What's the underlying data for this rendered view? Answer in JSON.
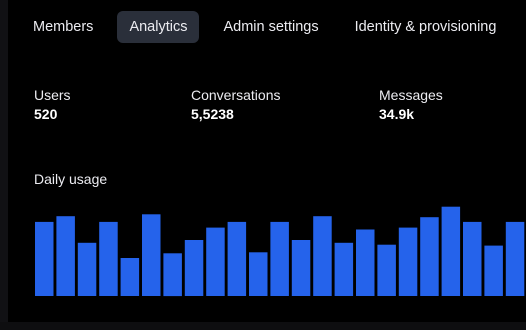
{
  "tabs": [
    {
      "label": "Members",
      "active": false
    },
    {
      "label": "Analytics",
      "active": true
    },
    {
      "label": "Admin settings",
      "active": false
    },
    {
      "label": "Identity & provisioning",
      "active": false
    }
  ],
  "stats": [
    {
      "label": "Users",
      "value": "520"
    },
    {
      "label": "Conversations",
      "value": "5,5238"
    },
    {
      "label": "Messages",
      "value": "34.9k"
    }
  ],
  "daily_usage": {
    "title": "Daily usage"
  },
  "chart_data": {
    "type": "bar",
    "title": "Daily usage",
    "xlabel": "",
    "ylabel": "",
    "values": [
      78,
      84,
      56,
      78,
      40,
      86,
      45,
      59,
      72,
      78,
      46,
      78,
      59,
      84,
      56,
      70,
      54,
      72,
      83,
      94,
      78,
      53,
      78
    ],
    "ylim": [
      0,
      100
    ],
    "bar_color": "#2563eb",
    "grid": false
  },
  "colors": {
    "background": "#000000",
    "active_tab": "#2a2f3a",
    "bar": "#2563eb"
  }
}
